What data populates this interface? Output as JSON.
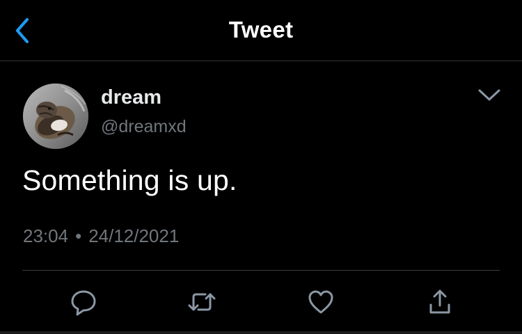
{
  "header": {
    "back_icon": "chevron-left-icon",
    "title": "Tweet"
  },
  "tweet": {
    "author": {
      "display_name": "dream",
      "handle": "@dreamxd",
      "avatar": "cat-photo-avatar"
    },
    "more_icon": "chevron-down-icon",
    "text": "Something is up.",
    "time": "23:04",
    "separator": "•",
    "date": "24/12/2021"
  },
  "actions": [
    {
      "name": "reply",
      "icon": "reply-icon"
    },
    {
      "name": "retweet",
      "icon": "retweet-icon"
    },
    {
      "name": "like",
      "icon": "heart-icon"
    },
    {
      "name": "share",
      "icon": "share-icon"
    }
  ],
  "colors": {
    "background": "#000000",
    "accent": "#1d9bf0",
    "primary_text": "#ffffff",
    "secondary_text": "#71767b",
    "divider": "#2f3336",
    "icon": "#8b98a5"
  }
}
